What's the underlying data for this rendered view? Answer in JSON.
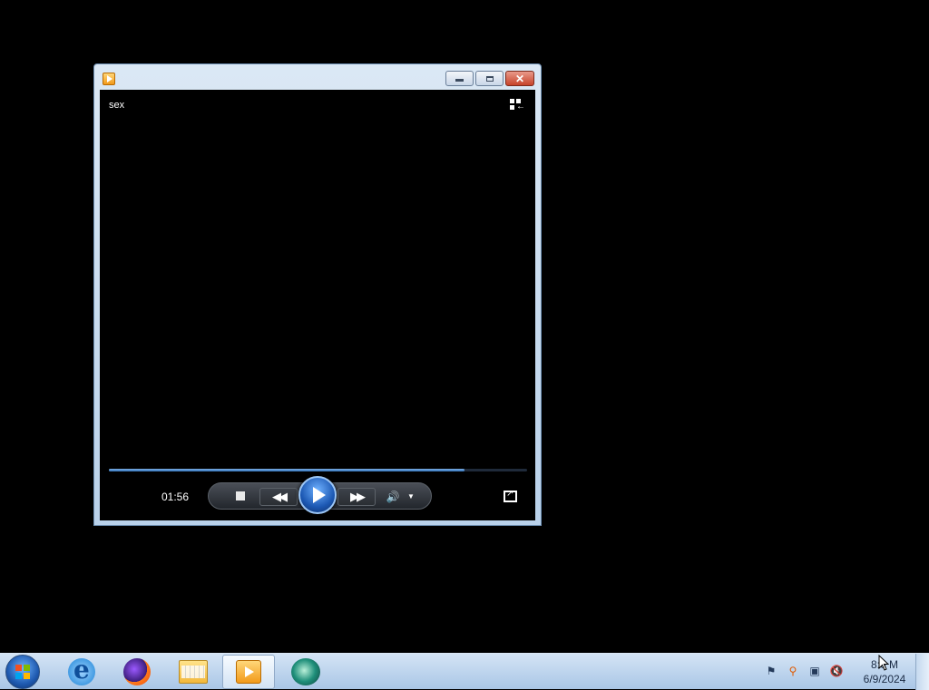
{
  "window": {
    "title": "",
    "media_title": "sex",
    "progress_fraction": 0.85,
    "elapsed_time": "01:56",
    "buttons": {
      "minimize": "minimize-icon",
      "maximize": "maximize-icon",
      "close": "close-icon"
    }
  },
  "taskbar": {
    "items": [
      "start",
      "internet-explorer",
      "firefox",
      "windows-explorer",
      "windows-media-player",
      "app"
    ],
    "tray_icons": [
      "action-center-flag-icon",
      "search-icon",
      "network-icon",
      "volume-muted-icon"
    ],
    "clock_time": "8:0 M",
    "clock_date": "6/9/2024"
  },
  "colors": {
    "progress": "#2f6fb6",
    "play_button": "#1c58b3",
    "taskbar": "#a9c6e6"
  }
}
